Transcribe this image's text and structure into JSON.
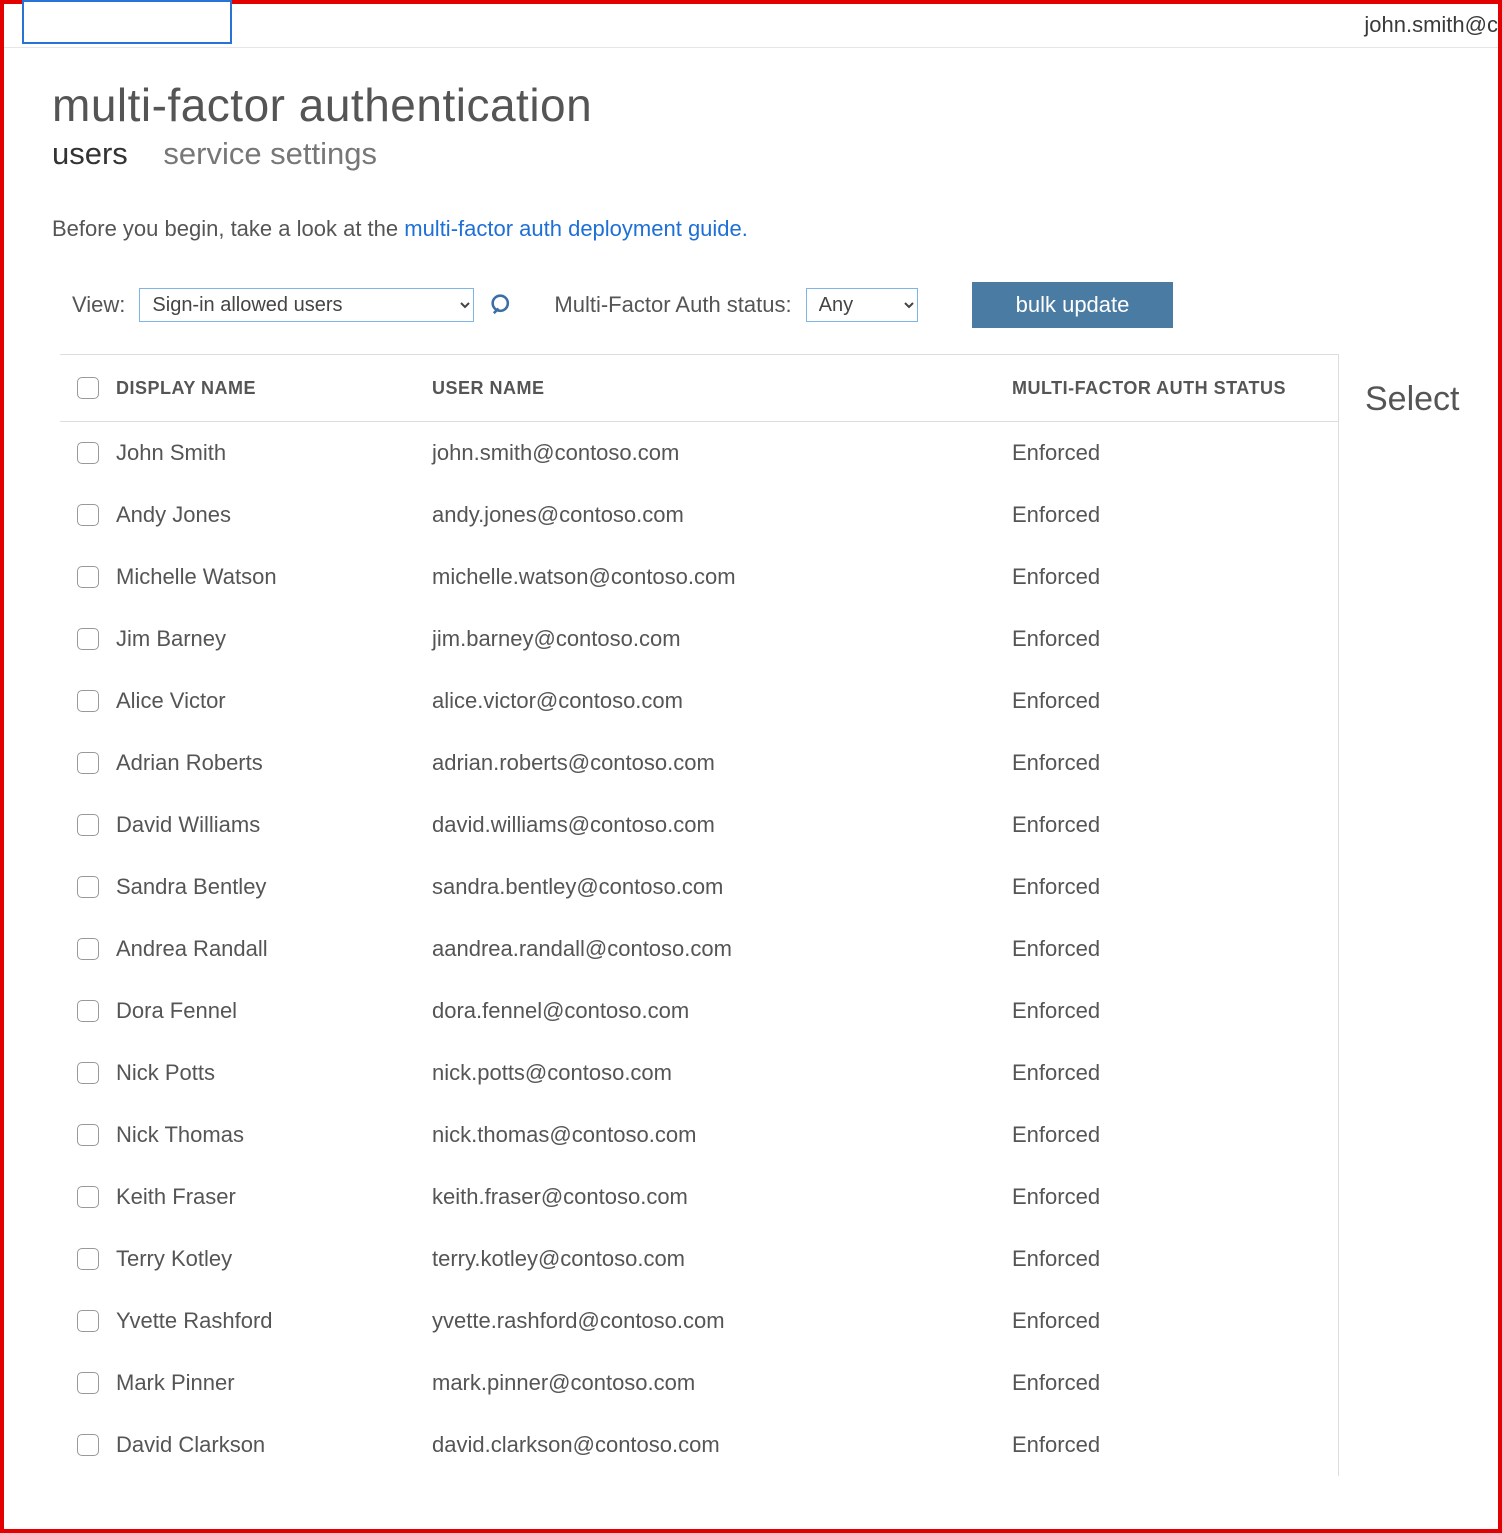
{
  "header": {
    "user_email": "john.smith@c"
  },
  "page": {
    "title": "multi-factor authentication",
    "tabs": [
      {
        "label": "users",
        "active": true
      },
      {
        "label": "service settings",
        "active": false
      }
    ],
    "intro_prefix": "Before you begin, take a look at the ",
    "intro_link": "multi-factor auth deployment guide.",
    "controls": {
      "view_label": "View:",
      "view_options": [
        "Sign-in allowed users"
      ],
      "view_selected": "Sign-in allowed users",
      "status_label": "Multi-Factor Auth status:",
      "status_options": [
        "Any"
      ],
      "status_selected": "Any",
      "bulk_update": "bulk update"
    }
  },
  "table": {
    "columns": {
      "display_name": "DISPLAY NAME",
      "user_name": "USER NAME",
      "mfa_status": "MULTI-FACTOR AUTH STATUS"
    },
    "rows": [
      {
        "display_name": "John Smith",
        "user_name": "john.smith@contoso.com",
        "mfa_status": "Enforced"
      },
      {
        "display_name": "Andy Jones",
        "user_name": "andy.jones@contoso.com",
        "mfa_status": "Enforced"
      },
      {
        "display_name": "Michelle Watson",
        "user_name": "michelle.watson@contoso.com",
        "mfa_status": "Enforced"
      },
      {
        "display_name": "Jim Barney",
        "user_name": "jim.barney@contoso.com",
        "mfa_status": "Enforced"
      },
      {
        "display_name": "Alice Victor",
        "user_name": "alice.victor@contoso.com",
        "mfa_status": "Enforced"
      },
      {
        "display_name": "Adrian Roberts",
        "user_name": "adrian.roberts@contoso.com",
        "mfa_status": "Enforced"
      },
      {
        "display_name": "David Williams",
        "user_name": "david.williams@contoso.com",
        "mfa_status": "Enforced"
      },
      {
        "display_name": "Sandra Bentley",
        "user_name": "sandra.bentley@contoso.com",
        "mfa_status": "Enforced"
      },
      {
        "display_name": "Andrea Randall",
        "user_name": "aandrea.randall@contoso.com",
        "mfa_status": "Enforced"
      },
      {
        "display_name": "Dora Fennel",
        "user_name": "dora.fennel@contoso.com",
        "mfa_status": "Enforced"
      },
      {
        "display_name": "Nick Potts",
        "user_name": "nick.potts@contoso.com",
        "mfa_status": "Enforced"
      },
      {
        "display_name": "Nick Thomas",
        "user_name": "nick.thomas@contoso.com",
        "mfa_status": "Enforced"
      },
      {
        "display_name": "Keith Fraser",
        "user_name": "keith.fraser@contoso.com",
        "mfa_status": "Enforced"
      },
      {
        "display_name": "Terry Kotley",
        "user_name": "terry.kotley@contoso.com",
        "mfa_status": "Enforced"
      },
      {
        "display_name": "Yvette Rashford",
        "user_name": "yvette.rashford@contoso.com",
        "mfa_status": "Enforced"
      },
      {
        "display_name": "Mark Pinner",
        "user_name": "mark.pinner@contoso.com",
        "mfa_status": "Enforced"
      },
      {
        "display_name": "David Clarkson",
        "user_name": "david.clarkson@contoso.com",
        "mfa_status": "Enforced"
      }
    ]
  },
  "side": {
    "select_title": "Select"
  }
}
